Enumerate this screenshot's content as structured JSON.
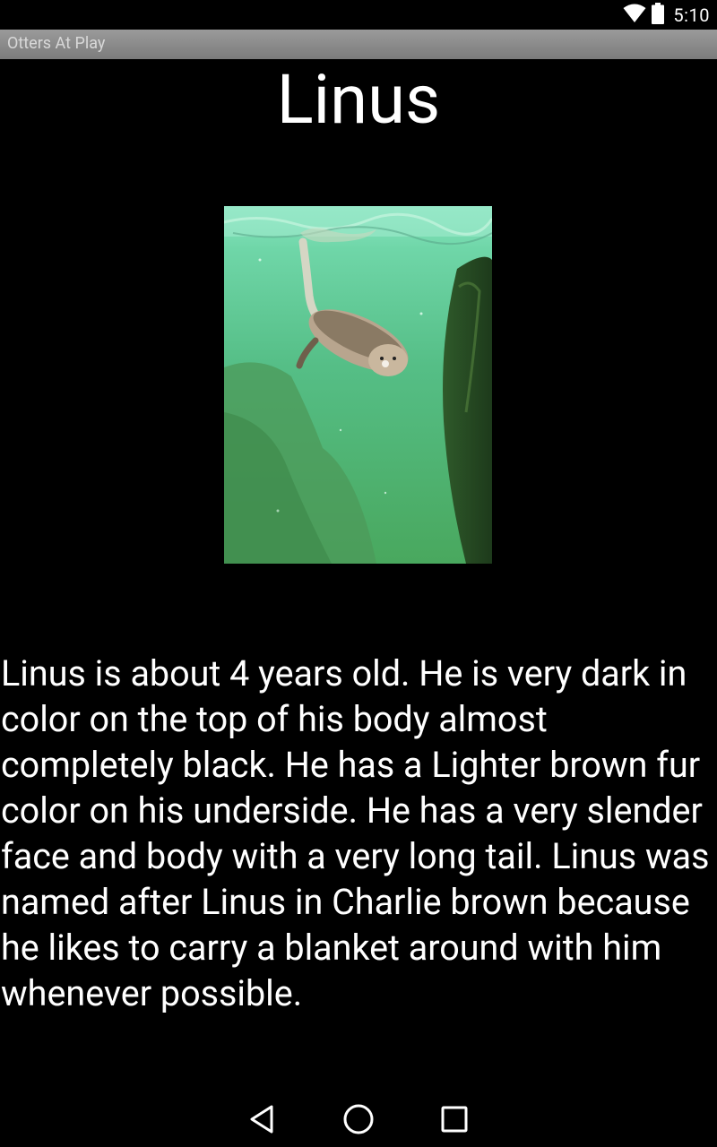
{
  "status_bar": {
    "time": "5:10",
    "icons": [
      "wifi-icon",
      "battery-icon"
    ]
  },
  "app_bar": {
    "title": "Otters At Play"
  },
  "otter": {
    "name": "Linus",
    "photo_icon": "otter-photo",
    "description": "Linus is about 4 years old. He is very dark in color on the top of his body almost completely black. He has a Lighter brown fur color on his underside. He has a very slender face and body with a very long tail. Linus was named after Linus in Charlie brown because he likes to carry a blanket around with him whenever possible."
  },
  "nav_bar": {
    "buttons": [
      "back-icon",
      "home-icon",
      "recents-icon"
    ]
  },
  "colors": {
    "background": "#000000",
    "app_bar": "#8a8a8a",
    "app_title_text": "#d8d8d8",
    "text": "#ffffff",
    "water": "#55c59a"
  }
}
